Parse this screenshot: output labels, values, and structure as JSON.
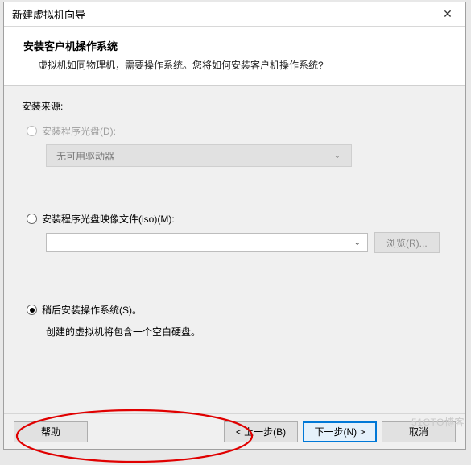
{
  "window": {
    "title": "新建虚拟机向导"
  },
  "header": {
    "title": "安装客户机操作系统",
    "description": "虚拟机如同物理机，需要操作系统。您将如何安装客户机操作系统?"
  },
  "source": {
    "label": "安装来源:",
    "disc": {
      "label": "安装程序光盘(D):",
      "dropdown_value": "无可用驱动器"
    },
    "iso": {
      "label": "安装程序光盘映像文件(iso)(M):",
      "browse_label": "浏览(R)..."
    },
    "later": {
      "label": "稍后安装操作系统(S)。",
      "note": "创建的虚拟机将包含一个空白硬盘。"
    }
  },
  "footer": {
    "help": "帮助",
    "back": "< 上一步(B)",
    "next": "下一步(N) >",
    "cancel": "取消"
  },
  "watermark": "51CTO博客"
}
